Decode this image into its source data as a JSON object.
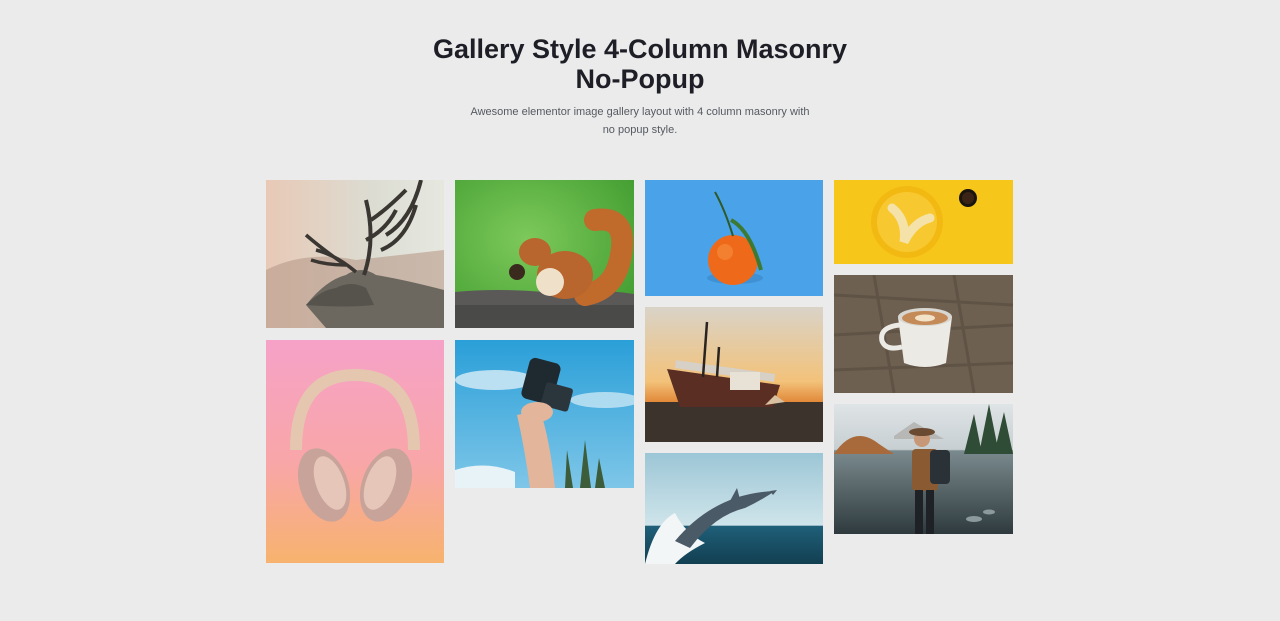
{
  "gallery": {
    "title": "Gallery Style 4-Column Masonry No-Popup",
    "subtitle": "Awesome elementor image gallery layout with 4 column masonry with no popup style."
  },
  "images": [
    {
      "id": "deer",
      "name": "deer-photo"
    },
    {
      "id": "squirrel",
      "name": "squirrel-photo"
    },
    {
      "id": "orange",
      "name": "tangerine-photo"
    },
    {
      "id": "banana",
      "name": "banana-plate-photo"
    },
    {
      "id": "headphones",
      "name": "headphones-photo"
    },
    {
      "id": "camera",
      "name": "camera-hand-photo"
    },
    {
      "id": "boat",
      "name": "shipwreck-photo"
    },
    {
      "id": "coffee",
      "name": "coffee-cup-photo"
    },
    {
      "id": "dolphin",
      "name": "dolphin-photo"
    },
    {
      "id": "hiker",
      "name": "hiker-lake-photo"
    }
  ],
  "colors": {
    "background": "#ebebeb",
    "title": "#1d1e26",
    "subtitle": "#555a61"
  }
}
